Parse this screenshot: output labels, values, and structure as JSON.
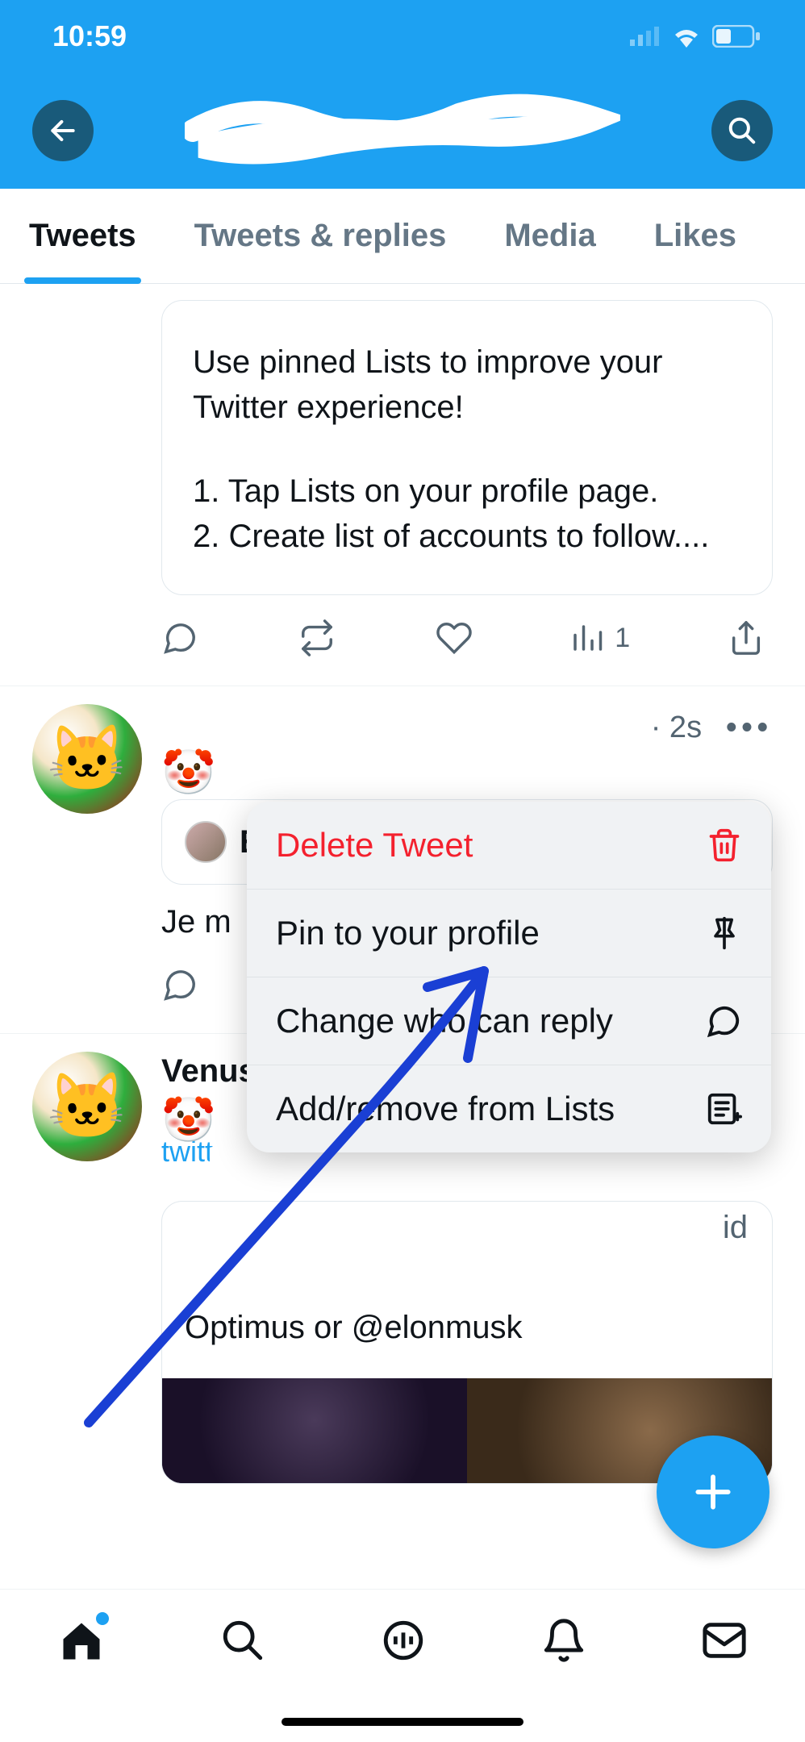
{
  "statusbar": {
    "time": "10:59"
  },
  "tabs": {
    "items": [
      {
        "label": "Tweets",
        "active": true
      },
      {
        "label": "Tweets & replies"
      },
      {
        "label": "Media"
      },
      {
        "label": "Likes"
      }
    ]
  },
  "pinned_card": {
    "line1": "Use pinned Lists to improve your Twitter experience!",
    "line2": "1. Tap Lists on your profile page.",
    "line3": "2. Create list of accounts to follow...."
  },
  "actions_row": {
    "analytics_count": "1"
  },
  "tweet1": {
    "time": "· 2s",
    "quoted_initial": "E",
    "body_fragment": "Je m"
  },
  "tweet2": {
    "name": "Venus",
    "handle_fragment": "twitt",
    "card_top_text": "id",
    "card_text": "Optimus or @elonmusk"
  },
  "context_menu": {
    "items": [
      {
        "label": "Delete Tweet",
        "danger": true
      },
      {
        "label": "Pin to your profile"
      },
      {
        "label": "Change who can reply"
      },
      {
        "label": "Add/remove from Lists"
      }
    ]
  },
  "icons": {
    "back": "back-arrow",
    "search": "search",
    "reply": "reply",
    "retweet": "retweet",
    "like": "like",
    "analytics": "analytics",
    "share": "share",
    "fab": "compose"
  }
}
